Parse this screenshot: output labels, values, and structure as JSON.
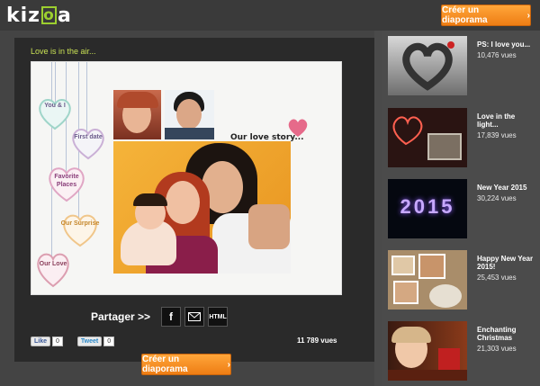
{
  "header": {
    "logo_text": "kizoa",
    "create_button": "Créer un diaporama"
  },
  "player": {
    "title": "Love is in the air...",
    "hearts": [
      "You & I",
      "First date",
      "Favorite Places",
      "Our Surprise",
      "Our Love"
    ],
    "love_story": "Our love story...",
    "share_label": "Partager >>",
    "share_icons": [
      "facebook-icon",
      "mail-icon",
      "html-icon"
    ],
    "html_label": "HTML"
  },
  "social": {
    "like_label": "Like",
    "like_count": "0",
    "tweet_label": "Tweet",
    "tweet_count": "0",
    "views": "11 789 vues"
  },
  "bottom_button": "Créer un diaporama",
  "sidebar": {
    "items": [
      {
        "name": "PS: I love you...",
        "views": "10,476 vues"
      },
      {
        "name": "Love in the light...",
        "views": "17,839 vues"
      },
      {
        "name": "New Year 2015",
        "views": "30,224 vues"
      },
      {
        "name": "Happy New Year 2015!",
        "views": "25,453 vues"
      },
      {
        "name": "Enchanting Christmas",
        "views": "21,303 vues"
      }
    ],
    "thumb_texts": {
      "year_2015": "2015"
    }
  },
  "colors": {
    "accent": "#ee7d14",
    "title": "#c8e054",
    "logo": "#9ccf2f"
  }
}
